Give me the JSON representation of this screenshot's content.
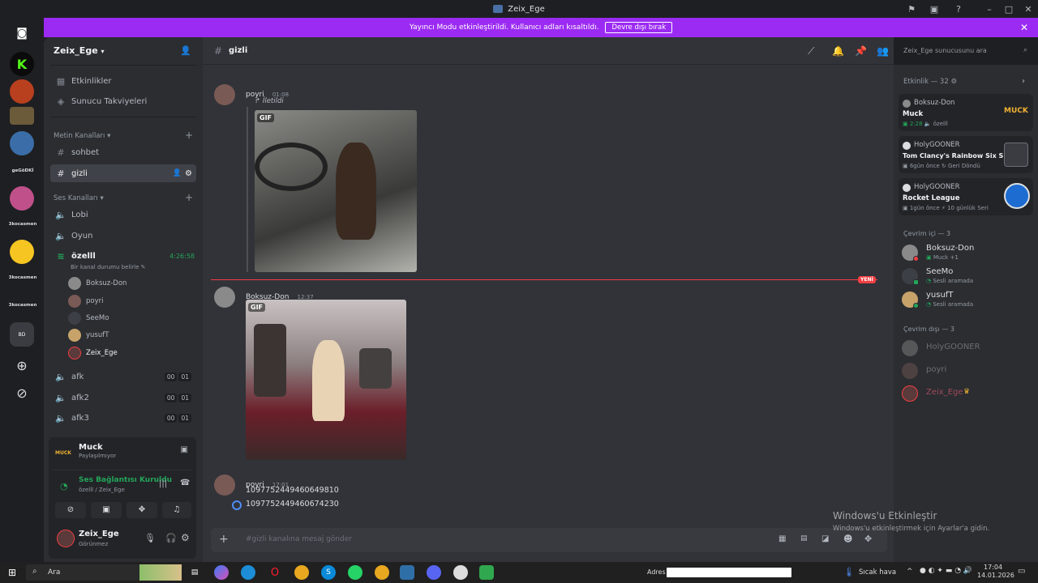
{
  "window": {
    "title": "Zeix_Ege"
  },
  "banner": {
    "text": "Yayıncı Modu etkinleştirildi. Kullanıcı adları kısaltıldı.",
    "button": "Devre dışı bırak"
  },
  "guilds": {
    "labels": [
      "geGöDKİ",
      "3kocasmen",
      "3kocasmen",
      "3kocasmen",
      "BD"
    ]
  },
  "sidebar": {
    "server_name": "Zeix_Ege",
    "top_items": [
      "Etkinlikler",
      "Sunucu Takviyeleri"
    ],
    "text_category": "Metin Kanalları",
    "text_channels": [
      "sohbet",
      "gizli"
    ],
    "voice_category": "Ses Kanalları",
    "voice_channels": [
      "Lobi",
      "Oyun"
    ],
    "active_voice": {
      "name": "özelll",
      "time": "4:26:58",
      "status": "Bir kanal durumu belirle"
    },
    "voice_members": [
      "Boksuz-Don",
      "poyri",
      "SeeMo",
      "yusufT",
      "Zeix_Ege"
    ],
    "afk_channels": [
      {
        "name": "afk",
        "a": "00",
        "b": "01"
      },
      {
        "name": "afk2",
        "a": "00",
        "b": "01"
      },
      {
        "name": "afk3",
        "a": "00",
        "b": "01"
      }
    ]
  },
  "panel": {
    "activity_title": "Muck",
    "activity_icon_text": "MUCK",
    "activity_sub": "Paylaşılmıyor",
    "voice_status": "Ses Bağlantısı Kuruldu",
    "voice_location": "özelll / Zeix_Ege",
    "user_name": "Zeix_Ege",
    "user_status": "Görünmez"
  },
  "chat": {
    "channel": "gizli",
    "search_placeholder": "Zeix_Ege sunucusunu ara",
    "messages": [
      {
        "author": "poyri",
        "time": "01:08",
        "forwarded": "İletildi",
        "gif": "GIF"
      },
      {
        "author": "Boksuz-Don",
        "time": "12:37",
        "gif": "GIF"
      },
      {
        "author": "poyri",
        "time": "17:01",
        "lines": [
          "1097752449460649810",
          "1097752449460674230"
        ]
      }
    ],
    "new_label": "YENİ",
    "composer_placeholder": "#gizli kanalına mesaj gönder"
  },
  "members": {
    "activity_header": "Etkinlik — 32",
    "activities": [
      {
        "user": "Boksuz-Don",
        "game": "Muck",
        "meta1": "2:28",
        "meta2": "özelll",
        "badge": "MUCK"
      },
      {
        "user": "HolyGOONER",
        "game": "Tom Clancy's Rainbow Six S...",
        "meta1": "6gün önce",
        "meta2": "Geri Döndü"
      },
      {
        "user": "HolyGOONER",
        "game": "Rocket League",
        "meta1": "1gün önce",
        "meta2": "10 günlük Seri"
      }
    ],
    "online_header": "Çevrim içi — 3",
    "online": [
      {
        "name": "Boksuz-Don",
        "sub": "Muck +1"
      },
      {
        "name": "SeeMo",
        "sub": "Sesli aramada"
      },
      {
        "name": "yusufT",
        "sub": "Sesli aramada"
      }
    ],
    "offline_header": "Çevrim dışı — 3",
    "offline": [
      "HolyGOONER",
      "poyri",
      "Zeix_Ege"
    ]
  },
  "windows": {
    "activate_title": "Windows'u Etkinleştir",
    "activate_sub": "Windows'u etkinleştirmek için Ayarlar'a gidin."
  },
  "taskbar": {
    "search": "Ara",
    "address_label": "Adres",
    "weather": "Sıcak hava",
    "time": "17:04",
    "date": "14.01.2026"
  },
  "colors": {
    "accent": "#9b2bf2",
    "new": "#f23f43",
    "online": "#23a55a",
    "brand": "#5865f2",
    "owner": "#f0b232"
  }
}
